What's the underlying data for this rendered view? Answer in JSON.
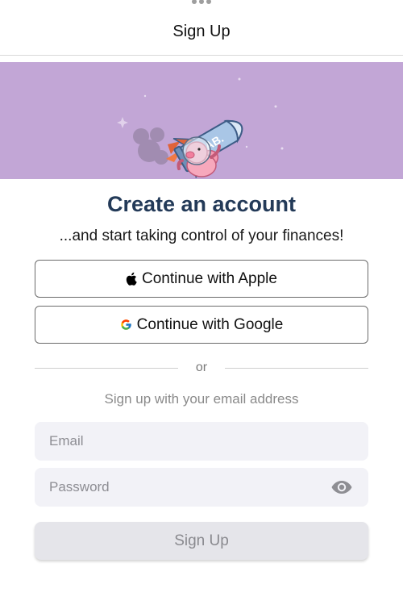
{
  "header": {
    "title": "Sign Up"
  },
  "hero": {
    "rocket_text": "YNAB.",
    "background_color": "#c2a6d6"
  },
  "main": {
    "title": "Create an account",
    "subtitle": "...and start taking control of your finances!",
    "apple_button": {
      "label": "Continue with Apple",
      "icon": "apple-icon"
    },
    "google_button": {
      "label": "Continue with Google",
      "icon": "google-icon"
    },
    "divider_text": "or",
    "email_prompt": "Sign up with your email address",
    "email": {
      "placeholder": "Email",
      "value": ""
    },
    "password": {
      "placeholder": "Password",
      "value": "",
      "toggle_icon": "eye-icon"
    },
    "submit_label": "Sign Up"
  },
  "colors": {
    "title": "#233a58",
    "submit_bg": "#e5e5ea",
    "field_bg": "#f2f2f7"
  }
}
